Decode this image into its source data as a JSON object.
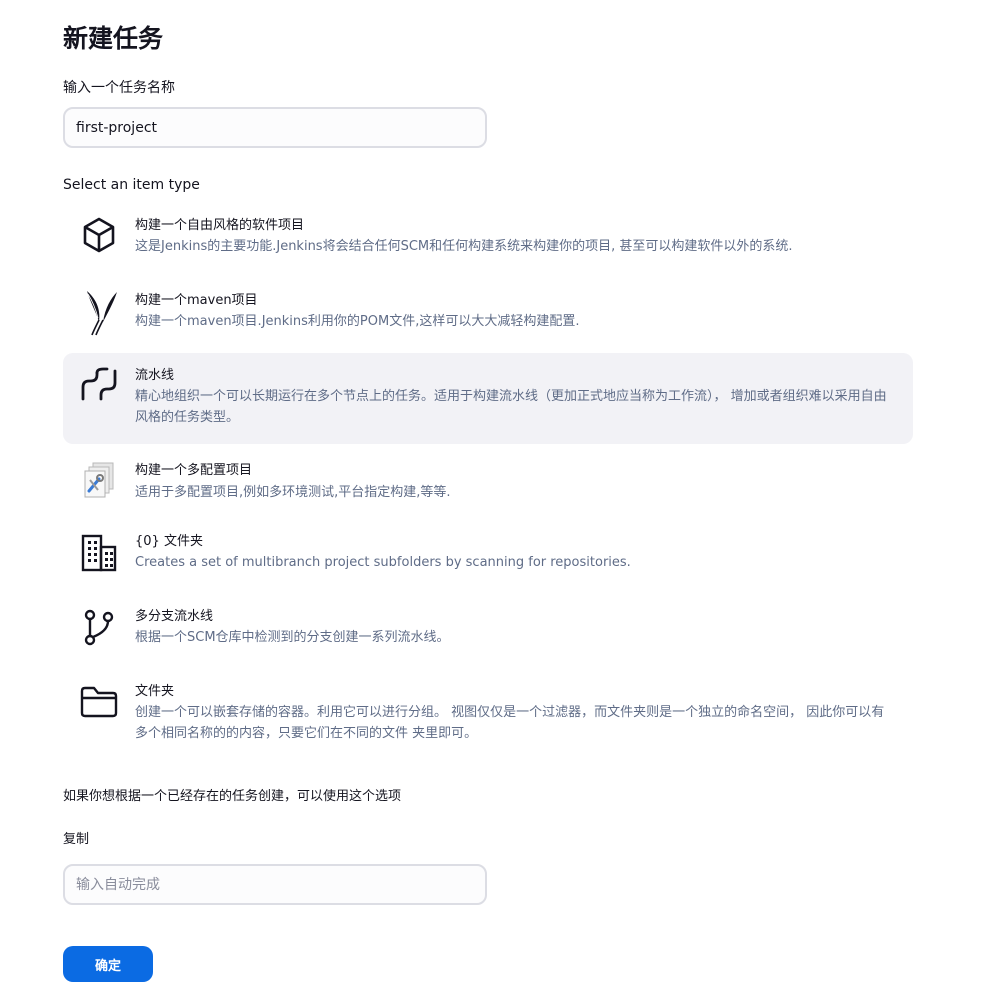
{
  "page": {
    "title": "新建任务"
  },
  "name_field": {
    "label": "输入一个任务名称",
    "value": "first-project"
  },
  "item_type": {
    "label": "Select an item type",
    "items": [
      {
        "id": "freestyle",
        "icon": "package-cube-icon",
        "name": "构建一个自由风格的软件项目",
        "description": "这是Jenkins的主要功能.Jenkins将会结合任何SCM和任何构建系统来构建你的项目, 甚至可以构建软件以外的系统.",
        "selected": false
      },
      {
        "id": "maven",
        "icon": "maven-feather-icon",
        "name": "构建一个maven项目",
        "description": "构建一个maven项目.Jenkins利用你的POM文件,这样可以大大减轻构建配置.",
        "selected": false
      },
      {
        "id": "pipeline",
        "icon": "pipeline-icon",
        "name": "流水线",
        "description": "精心地组织一个可以长期运行在多个节点上的任务。适用于构建流水线（更加正式地应当称为工作流）， 增加或者组织难以采用自由风格的任务类型。",
        "selected": true
      },
      {
        "id": "matrix",
        "icon": "multi-config-icon",
        "name": "构建一个多配置项目",
        "description": "适用于多配置项目,例如多环境测试,平台指定构建,等等.",
        "selected": false
      },
      {
        "id": "org-folder",
        "icon": "organization-building-icon",
        "name": "{0} 文件夹",
        "description": "Creates a set of multibranch project subfolders by scanning for repositories.",
        "selected": false
      },
      {
        "id": "multibranch",
        "icon": "git-branch-icon",
        "name": "多分支流水线",
        "description": "根据一个SCM仓库中检测到的分支创建一系列流水线。",
        "selected": false
      },
      {
        "id": "folder",
        "icon": "folder-icon",
        "name": "文件夹",
        "description": "创建一个可以嵌套存储的容器。利用它可以进行分组。 视图仅仅是一个过滤器，而文件夹则是一个独立的命名空间， 因此你可以有多个相同名称的的内容，只要它们在不同的文件 夹里即可。",
        "selected": false
      }
    ]
  },
  "copy_section": {
    "hint": "如果你想根据一个已经存在的任务创建，可以使用这个选项",
    "label": "复制",
    "placeholder": "输入自动完成"
  },
  "ok_button": {
    "label": "确定"
  },
  "colors": {
    "accent": "#0b6be3",
    "selected_bg": "#f2f2f6",
    "description_text": "#5f6c87"
  }
}
